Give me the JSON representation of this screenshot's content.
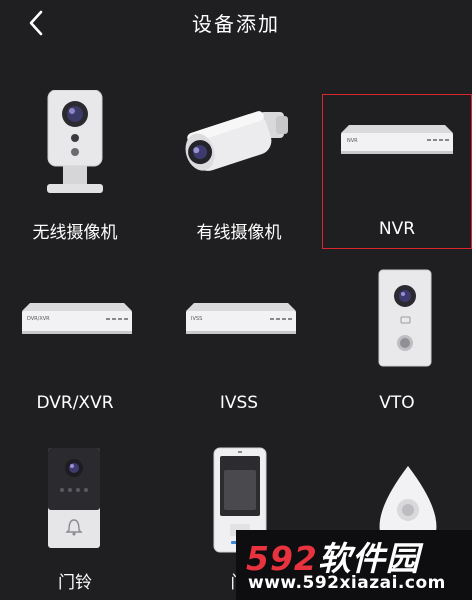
{
  "nav": {
    "back_icon": "chevron-left-icon",
    "title": "设备添加"
  },
  "devices": [
    {
      "label": "无线摄像机",
      "icon": "wireless-camera-icon"
    },
    {
      "label": "有线摄像机",
      "icon": "wired-bullet-camera-icon"
    },
    {
      "label": "NVR",
      "icon": "nvr-recorder-icon",
      "selected": true
    },
    {
      "label": "DVR/XVR",
      "icon": "dvr-recorder-icon",
      "device_text": "DVR/XVR"
    },
    {
      "label": "IVSS",
      "icon": "ivss-recorder-icon",
      "device_text": "IVSS"
    },
    {
      "label": "VTO",
      "icon": "vto-door-station-icon"
    },
    {
      "label": "门铃",
      "icon": "doorbell-icon"
    },
    {
      "label": "门",
      "icon": "access-terminal-icon"
    },
    {
      "label": "",
      "icon": "dome-device-icon"
    }
  ],
  "watermark": {
    "brand_num": "592",
    "brand_text": "软件园",
    "url": "www.592xiazai.com"
  },
  "colors": {
    "background": "#1f1f21",
    "selection": "#d9262e",
    "watermark_red": "#e8333e"
  }
}
